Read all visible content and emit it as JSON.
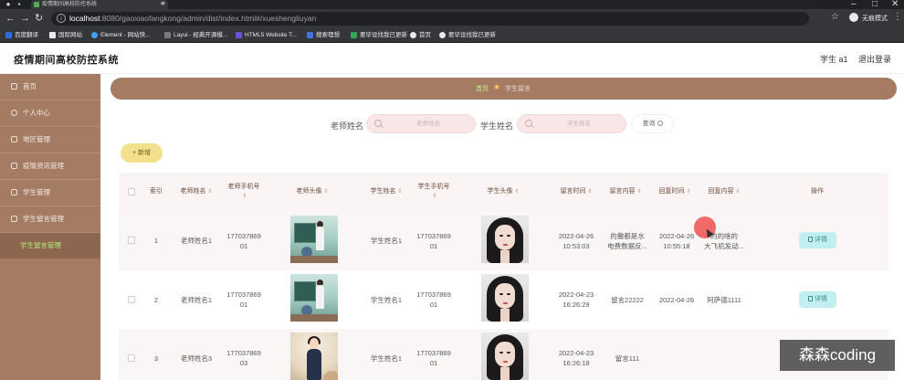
{
  "browser": {
    "tab_title": "疫情期间高校防控系统",
    "url_host": "localhost",
    "url_rest": ":8080/gaoxiaofangkong/admin/dist/index.html#/xueshengliuyan",
    "profile_label": "无痕模式",
    "bookmarks": [
      {
        "label": "百度翻译",
        "color": "#2b6cdf"
      },
      {
        "label": "国际网站",
        "color": "#e8eaed"
      },
      {
        "label": "Element - 网站快...",
        "color": "#409eff"
      },
      {
        "label": "Layui - 经典开源模...",
        "color": "#7a7a7a"
      },
      {
        "label": "HTML5 Website T...",
        "color": "#6b4fd8"
      },
      {
        "label": "搜索理想",
        "color": "#3b73e0"
      },
      {
        "label": "要毕设找我已更新",
        "color": "#33a852"
      },
      {
        "label": "首页",
        "color": "#e8eaed"
      },
      {
        "label": "要毕设找我已更新",
        "color": "#e8eaed"
      }
    ]
  },
  "app": {
    "title": "疫情期间高校防控系统",
    "user": "学生 a1",
    "logout": "退出登录"
  },
  "sidebar": {
    "items": [
      {
        "label": "首页"
      },
      {
        "label": "个人中心"
      },
      {
        "label": "地区管理"
      },
      {
        "label": "疫情资讯管理"
      },
      {
        "label": "学生管理"
      },
      {
        "label": "学生留言管理"
      }
    ],
    "sub_item": "学生留言管理"
  },
  "breadcrumb": {
    "home": "首页",
    "current": "学生留言"
  },
  "search": {
    "teacher_label": "老师姓名",
    "teacher_placeholder": "老师姓名",
    "student_label": "学生姓名",
    "student_placeholder": "学生姓名",
    "query_label": "查询"
  },
  "toolbar": {
    "add_label": "+ 新增"
  },
  "table": {
    "headers": {
      "index": "索引",
      "teacher_name": "老师姓名",
      "teacher_phone": "老师手机号",
      "teacher_avatar": "老师头像",
      "student_name": "学生姓名",
      "student_phone": "学生手机号",
      "student_avatar": "学生头像",
      "msg_time": "留言时间",
      "msg_content": "留言内容",
      "reply_time": "回复时间",
      "reply_content": "回复内容",
      "action": "操作"
    },
    "rows": [
      {
        "index": "1",
        "teacher_name": "老师姓名1",
        "teacher_phone_a": "177037869",
        "teacher_phone_b": "01",
        "student_name": "学生姓名1",
        "student_phone_a": "177037869",
        "student_phone_b": "01",
        "msg_date": "2022-04-26",
        "msg_time": "10:53:03",
        "msg_content_a": "的撒都是水",
        "msg_content_b": "电费数据反...",
        "reply_date": "2022-04-26",
        "reply_time": "10:55:18",
        "reply_content_a": "的的啥的",
        "reply_content_b": "大飞机发动...",
        "action": "详情"
      },
      {
        "index": "2",
        "teacher_name": "老师姓名1",
        "teacher_phone_a": "177037869",
        "teacher_phone_b": "01",
        "student_name": "学生姓名1",
        "student_phone_a": "177037869",
        "student_phone_b": "01",
        "msg_date": "2022-04-23",
        "msg_time": "16:26:29",
        "msg_content_a": "留言22222",
        "msg_content_b": "",
        "reply_date": "2022-04-26",
        "reply_time": "",
        "reply_content_a": "阿萨德1111",
        "reply_content_b": "",
        "action": "详情"
      },
      {
        "index": "3",
        "teacher_name": "老师姓名3",
        "teacher_phone_a": "177037869",
        "teacher_phone_b": "03",
        "student_name": "学生姓名1",
        "student_phone_a": "177037869",
        "student_phone_b": "01",
        "msg_date": "2022-04-23",
        "msg_time": "16:26:18",
        "msg_content_a": "留言111",
        "msg_content_b": "",
        "reply_date": "",
        "reply_time": "",
        "reply_content_a": "",
        "reply_content_b": "",
        "action": ""
      }
    ]
  },
  "watermark": "森森coding",
  "colors": {
    "sidebar": "#a57c63",
    "accent_green": "#b6ef7a",
    "add_button": "#f2e08d",
    "detail_button": "#c1efef",
    "search_input": "#f9e7e7"
  }
}
